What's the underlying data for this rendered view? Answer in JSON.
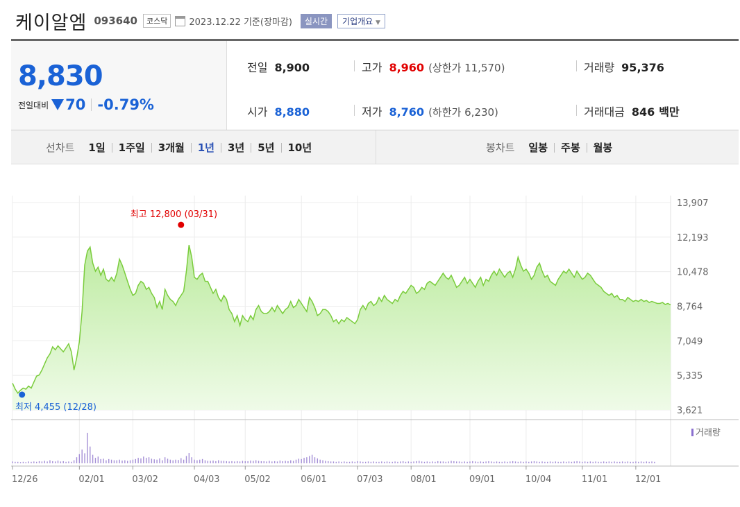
{
  "header": {
    "name": "케이알엠",
    "code": "093640",
    "market": "코스닥",
    "date": "2023.12.22",
    "basis": "기준(장마감)",
    "realtime": "실시간",
    "overview": "기업개요"
  },
  "quote": {
    "price": "8,830",
    "change_label": "전일대비",
    "change": "70",
    "change_pct": "-0.79%",
    "prev_close_label": "전일",
    "prev_close": "8,900",
    "high_label": "고가",
    "high": "8,960",
    "upper_limit_text": "(상한가 11,570)",
    "volume_label": "거래량",
    "volume": "95,376",
    "open_label": "시가",
    "open": "8,880",
    "low_label": "저가",
    "low": "8,760",
    "lower_limit_text": "(하한가 6,230)",
    "amount_label": "거래대금",
    "amount": "846",
    "amount_unit": "백만"
  },
  "tabs": {
    "line_label": "선차트",
    "line_periods": [
      "1일",
      "1주일",
      "3개월",
      "1년",
      "3년",
      "5년",
      "10년"
    ],
    "active_period": "1년",
    "candle_label": "봉차트",
    "candle_periods": [
      "일봉",
      "주봉",
      "월봉"
    ]
  },
  "chart_data": {
    "type": "area",
    "accent_color": "#7acc3c",
    "fill_color": "#c9f0b0",
    "y_ticks": [
      "13,907",
      "12,193",
      "10,478",
      "8,764",
      "7,049",
      "5,335",
      "3,621"
    ],
    "y_tick_values": [
      13907,
      12193,
      10478,
      8764,
      7049,
      5335,
      3621
    ],
    "ylim": [
      3621,
      13907
    ],
    "x_ticks": [
      "12/26",
      "02/01",
      "03/02",
      "04/03",
      "05/02",
      "06/01",
      "07/03",
      "08/01",
      "09/01",
      "10/04",
      "11/01",
      "12/01"
    ],
    "x_tick_index": [
      0,
      25,
      45,
      68,
      87,
      108,
      129,
      149,
      171,
      192,
      213,
      233
    ],
    "max_label": "최고 12,800 (03/31)",
    "max_index": 63,
    "max_value": 12800,
    "min_label": "최저 4,455 (12/28)",
    "min_index": 2,
    "min_value": 4455,
    "volume_legend": "거래량",
    "values": [
      4950,
      4650,
      4455,
      4600,
      4700,
      4650,
      4800,
      4700,
      5000,
      5300,
      5350,
      5600,
      5900,
      6200,
      6400,
      6750,
      6600,
      6800,
      6650,
      6500,
      6700,
      6900,
      6500,
      5600,
      6200,
      7000,
      8500,
      10800,
      11500,
      11700,
      10900,
      10500,
      10700,
      10300,
      10600,
      10100,
      10000,
      10200,
      10000,
      10400,
      11100,
      10800,
      10400,
      10000,
      9600,
      9300,
      9400,
      9800,
      10000,
      9900,
      9600,
      9700,
      9400,
      9200,
      8700,
      9000,
      8600,
      9600,
      9300,
      9100,
      9000,
      8800,
      9100,
      9300,
      9500,
      10500,
      11800,
      11200,
      10200,
      10100,
      10300,
      10400,
      10000,
      10000,
      9700,
      9400,
      9600,
      9200,
      9000,
      9300,
      9100,
      8600,
      8400,
      8000,
      8300,
      7800,
      8300,
      8100,
      8000,
      8300,
      8100,
      8600,
      8800,
      8500,
      8400,
      8400,
      8500,
      8700,
      8500,
      8800,
      8600,
      8400,
      8600,
      8700,
      9000,
      8700,
      8800,
      9100,
      8900,
      8700,
      8500,
      9200,
      9000,
      8700,
      8300,
      8400,
      8600,
      8600,
      8500,
      8300,
      8000,
      8100,
      7900,
      8100,
      8000,
      8200,
      8100,
      8000,
      7900,
      8100,
      8600,
      8800,
      8600,
      8900,
      9000,
      8800,
      8900,
      9200,
      9000,
      9300,
      9100,
      9000,
      8900,
      9100,
      9000,
      9300,
      9500,
      9400,
      9600,
      9800,
      9700,
      9400,
      9500,
      9700,
      9600,
      9900,
      10000,
      9900,
      9800,
      10000,
      10200,
      10400,
      10200,
      10100,
      10300,
      10000,
      9700,
      9800,
      10000,
      10200,
      9900,
      10100,
      9900,
      9700,
      10000,
      10200,
      9800,
      10100,
      10000,
      10300,
      10500,
      10300,
      10600,
      10400,
      10200,
      10400,
      10500,
      10200,
      10600,
      11200,
      10800,
      10500,
      10600,
      10400,
      10100,
      10300,
      10700,
      10900,
      10500,
      10200,
      10300,
      10000,
      9900,
      9800,
      10100,
      10300,
      10500,
      10400,
      10600,
      10400,
      10200,
      10500,
      10300,
      10100,
      10200,
      10400,
      10300,
      10100,
      9900,
      9800,
      9700,
      9500,
      9400,
      9300,
      9400,
      9200,
      9300,
      9100,
      9100,
      9000,
      9200,
      9100,
      9000,
      9050,
      9000,
      9100,
      9000,
      9050,
      8950,
      9000,
      8950,
      8900,
      8900,
      8950,
      8850,
      8900,
      8830
    ],
    "volumes": [
      0.06,
      0.05,
      0.05,
      0.04,
      0.05,
      0.04,
      0.06,
      0.05,
      0.06,
      0.05,
      0.07,
      0.06,
      0.08,
      0.06,
      0.1,
      0.07,
      0.06,
      0.09,
      0.06,
      0.07,
      0.05,
      0.06,
      0.05,
      0.1,
      0.2,
      0.3,
      0.45,
      0.33,
      1.0,
      0.55,
      0.28,
      0.18,
      0.22,
      0.14,
      0.15,
      0.1,
      0.14,
      0.12,
      0.1,
      0.1,
      0.12,
      0.09,
      0.1,
      0.08,
      0.1,
      0.12,
      0.14,
      0.18,
      0.16,
      0.22,
      0.18,
      0.2,
      0.15,
      0.13,
      0.12,
      0.16,
      0.1,
      0.2,
      0.15,
      0.12,
      0.1,
      0.12,
      0.11,
      0.17,
      0.12,
      0.24,
      0.34,
      0.2,
      0.12,
      0.1,
      0.12,
      0.14,
      0.1,
      0.08,
      0.08,
      0.09,
      0.07,
      0.1,
      0.08,
      0.08,
      0.07,
      0.06,
      0.07,
      0.06,
      0.07,
      0.06,
      0.08,
      0.07,
      0.07,
      0.09,
      0.08,
      0.1,
      0.08,
      0.07,
      0.07,
      0.06,
      0.08,
      0.06,
      0.07,
      0.06,
      0.09,
      0.07,
      0.08,
      0.07,
      0.1,
      0.08,
      0.12,
      0.15,
      0.14,
      0.18,
      0.2,
      0.24,
      0.28,
      0.2,
      0.16,
      0.12,
      0.1,
      0.08,
      0.07,
      0.06,
      0.06,
      0.05,
      0.06,
      0.05,
      0.06,
      0.05,
      0.05,
      0.06,
      0.05,
      0.07,
      0.06,
      0.05,
      0.05,
      0.06,
      0.05,
      0.06,
      0.05,
      0.05,
      0.06,
      0.05,
      0.06,
      0.05,
      0.05,
      0.06,
      0.05,
      0.06,
      0.07,
      0.05,
      0.06,
      0.05,
      0.06,
      0.07,
      0.08,
      0.06,
      0.05,
      0.06,
      0.05,
      0.06,
      0.05,
      0.07,
      0.06,
      0.06,
      0.05,
      0.06,
      0.08,
      0.07,
      0.06,
      0.06,
      0.05,
      0.06,
      0.05,
      0.06,
      0.07,
      0.06,
      0.05,
      0.06,
      0.05,
      0.06,
      0.07,
      0.06,
      0.05,
      0.06,
      0.05,
      0.05,
      0.06,
      0.05,
      0.06,
      0.07,
      0.06,
      0.05,
      0.06,
      0.05,
      0.06,
      0.05,
      0.06,
      0.07,
      0.06,
      0.05,
      0.06,
      0.05,
      0.05,
      0.06,
      0.05,
      0.06,
      0.05,
      0.05,
      0.06,
      0.05,
      0.06,
      0.05,
      0.06,
      0.07,
      0.06,
      0.05,
      0.06,
      0.05,
      0.06,
      0.05,
      0.06,
      0.05,
      0.05,
      0.06,
      0.05,
      0.06,
      0.05,
      0.06,
      0.05,
      0.05,
      0.06,
      0.05,
      0.06,
      0.05,
      0.05,
      0.06,
      0.05,
      0.06,
      0.05,
      0.06,
      0.05,
      0.06,
      0.05
    ]
  }
}
